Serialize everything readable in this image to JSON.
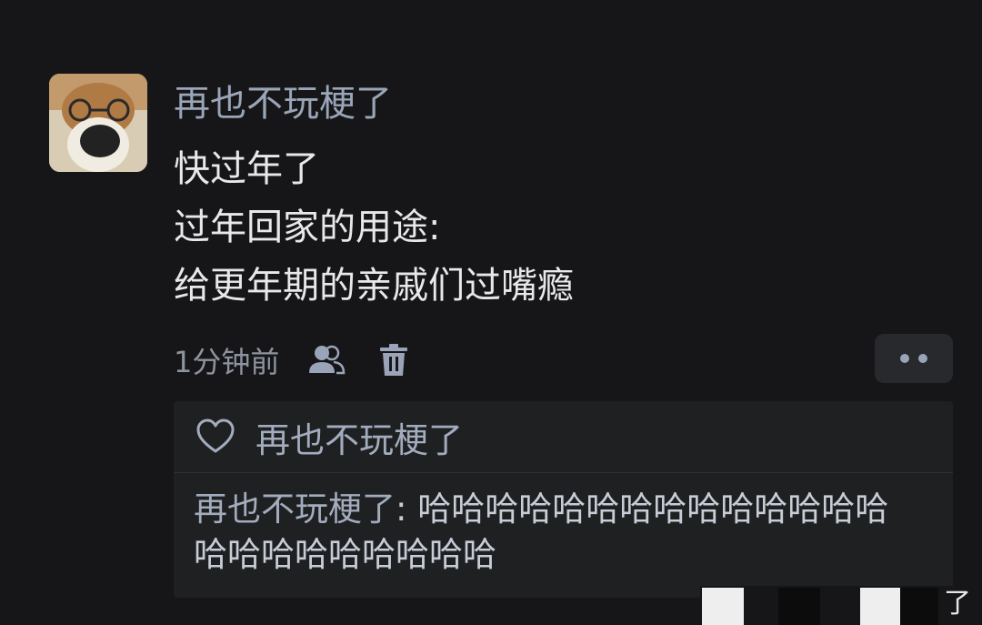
{
  "comment": {
    "username": "再也不玩梗了",
    "content_lines": [
      "快过年了",
      "过年回家的用途:",
      "给更年期的亲戚们过嘴瘾"
    ],
    "timestamp": "1分钟前",
    "actions": {
      "icons": [
        "people-icon",
        "trash-icon"
      ],
      "more_icon": "more-dots-icon"
    }
  },
  "likes": {
    "icon": "heart-icon",
    "liker_name": "再也不玩梗了"
  },
  "reply": {
    "author": "再也不玩梗了",
    "separator": ": ",
    "text": "哈哈哈哈哈哈哈哈哈哈哈哈哈哈哈哈哈哈哈哈哈哈哈"
  },
  "watermark": {
    "text": "了"
  },
  "colors": {
    "background": "#161618",
    "username": "#9aa5b8",
    "content": "#e8e8ea",
    "meta": "#8e949e",
    "reply_box": "#1f2022"
  }
}
